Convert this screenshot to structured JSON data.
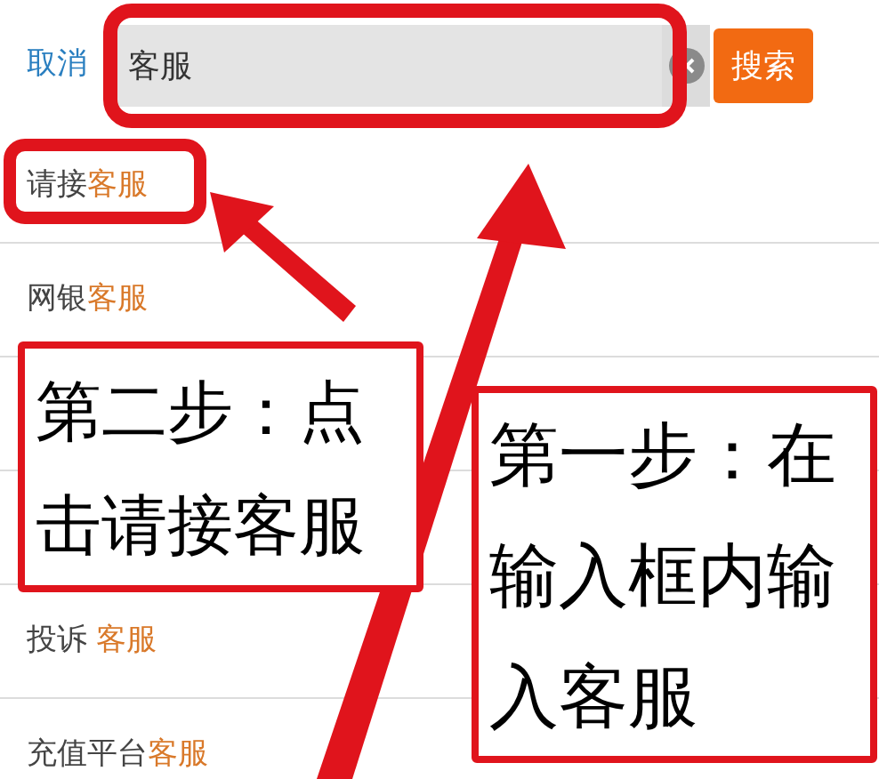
{
  "header": {
    "cancel": "取消",
    "search": {
      "value": "客服"
    },
    "search_button": "搜索"
  },
  "results": [
    {
      "prefix": "请接",
      "keyword": "客服",
      "spaced": false
    },
    {
      "prefix": "网银",
      "keyword": "客服",
      "spaced": false
    },
    {
      "prefix": "投诉",
      "keyword": "客服",
      "spaced": true
    },
    {
      "prefix": "充值平台",
      "keyword": "客服",
      "spaced": false
    }
  ],
  "annotations": [
    {
      "kind": "step2",
      "text": "第二步：点击请接客服"
    },
    {
      "kind": "step1",
      "text": "第一步：在输入框内输入客服"
    }
  ]
}
